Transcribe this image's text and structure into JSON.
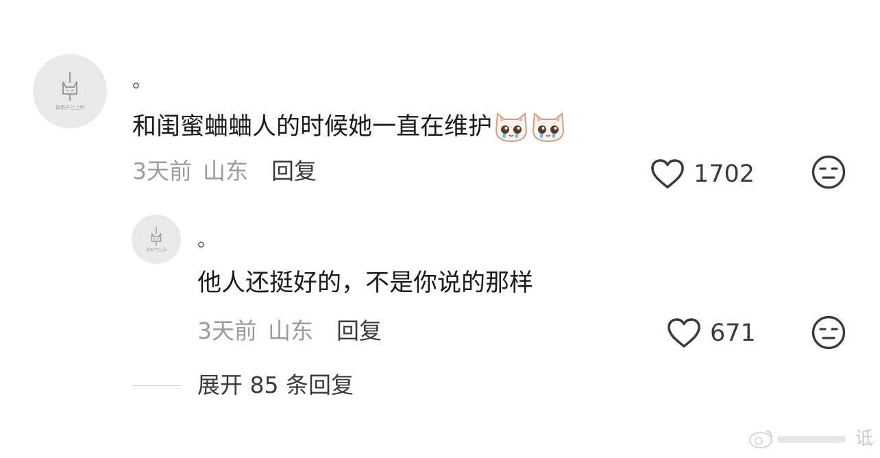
{
  "comments": [
    {
      "avatar_caption": "该用户已上吊",
      "username": "。",
      "text": "和闺蜜蛐蛐人的时候她一直在维护",
      "emoji_icon": "crying-cat-face-icon",
      "emoji_count": 2,
      "time": "3天前",
      "location": "山东",
      "reply_label": "回复",
      "likes": "1702"
    },
    {
      "avatar_caption": "该用户已上吊",
      "username": "。",
      "text": "他人还挺好的，不是你说的那样",
      "time": "3天前",
      "location": "山东",
      "reply_label": "回复",
      "likes": "671"
    }
  ],
  "expand_replies": "展开 85 条回复",
  "icons": {
    "like": "heart-outline-icon",
    "dislike": "neutral-face-icon"
  },
  "colors": {
    "text": "#1a1a1a",
    "meta": "#9b9b9b",
    "secondary": "#3a3a3a",
    "avatar_bg": "#e9e9e9"
  }
}
